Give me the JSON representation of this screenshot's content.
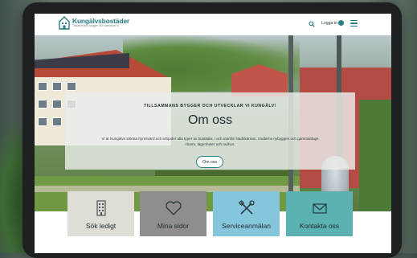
{
  "colors": {
    "brand": "#2a7f85",
    "tile_sok": "#e0dcd6",
    "tile_mina": "#8f8e8c",
    "tile_service": "#86c6dc",
    "tile_kontakta": "#5cb2b0"
  },
  "header": {
    "logo_name": "Kungälvsbostäder",
    "logo_tagline": "Tillsammans bygger och utvecklar vi",
    "login_label": "Logga in",
    "icons": [
      "search-icon",
      "user-icon",
      "hamburger-menu-icon"
    ]
  },
  "hero": {
    "kicker": "TILLSAMMANS BYGGER OCH UTVECKLAR VI KUNGÄLV!",
    "title": "Om oss",
    "description": "Vi är Kungälvs största hyresvärd och erbjuder alla typer av bostäder, i och utanför stadskärnan, moderna nybyggen och gammaldags charm, lägenheter och radhus.",
    "button_label": "Om oss"
  },
  "quick_links": [
    {
      "label": "Sök ledigt",
      "icon": "building-icon"
    },
    {
      "label": "Mina sidor",
      "icon": "heart-icon"
    },
    {
      "label": "Serviceanmälan",
      "icon": "tools-icon"
    },
    {
      "label": "Kontakta oss",
      "icon": "envelope-icon"
    }
  ]
}
